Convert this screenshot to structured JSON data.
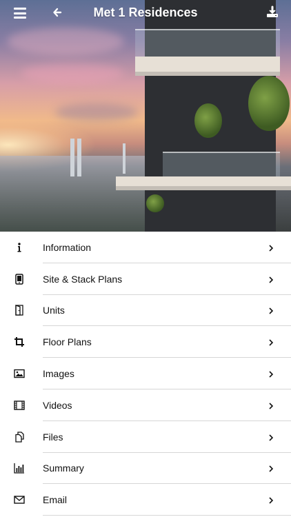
{
  "header": {
    "title": "Met 1 Residences",
    "icons": {
      "menu": "hamburger-menu-icon",
      "back": "back-arrow-icon",
      "download": "download-icon"
    }
  },
  "menu": {
    "items": [
      {
        "label": "Information",
        "icon": "info-icon"
      },
      {
        "label": "Site & Stack Plans",
        "icon": "tablet-icon"
      },
      {
        "label": "Units",
        "icon": "door-icon"
      },
      {
        "label": "Floor Plans",
        "icon": "crop-icon"
      },
      {
        "label": "Images",
        "icon": "image-icon"
      },
      {
        "label": "Videos",
        "icon": "film-icon"
      },
      {
        "label": "Files",
        "icon": "files-icon"
      },
      {
        "label": "Summary",
        "icon": "bar-chart-icon"
      },
      {
        "label": "Email",
        "icon": "email-icon"
      }
    ]
  },
  "colors": {
    "text": "#111111",
    "divider": "#d6d6d6",
    "header_text": "#ffffff"
  }
}
